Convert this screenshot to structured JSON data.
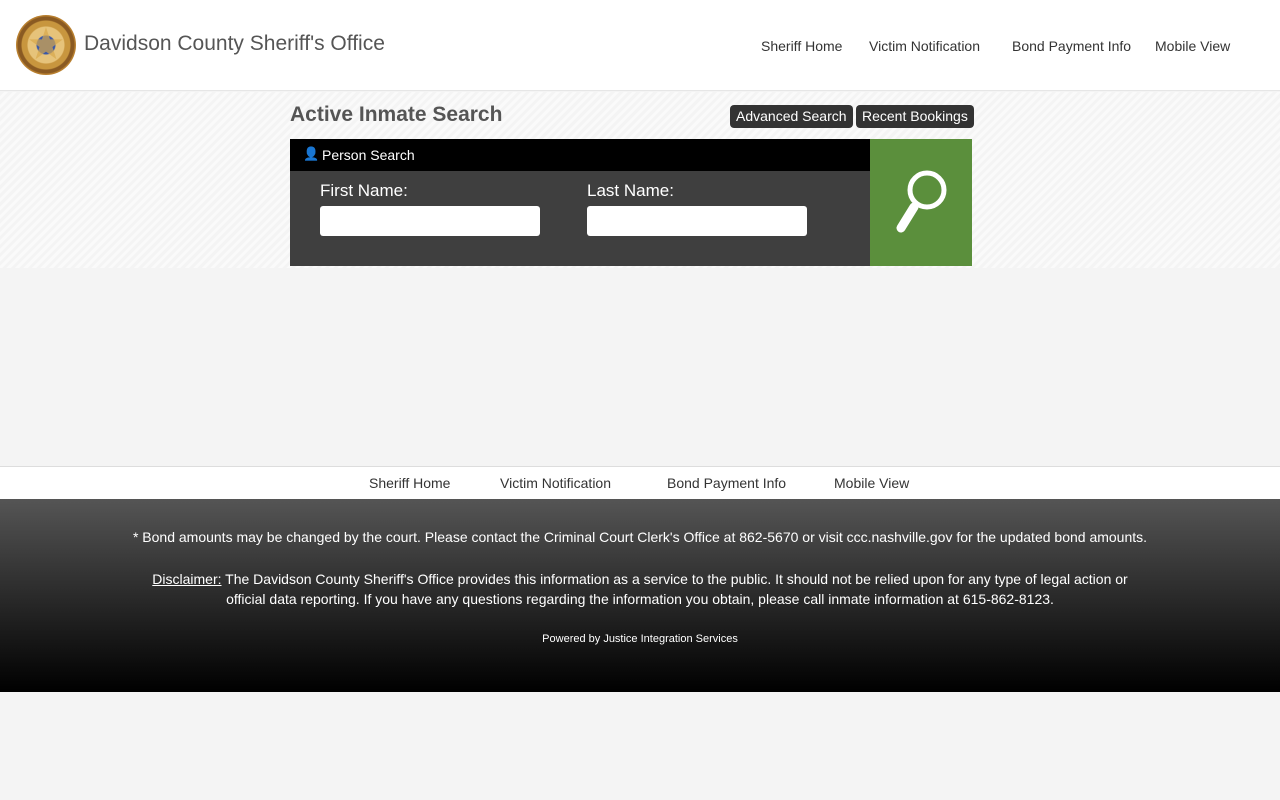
{
  "header": {
    "title": "Davidson County Sheriff's Office",
    "nav": [
      "Sheriff Home",
      "Victim Notification",
      "Bond Payment Info",
      "Mobile View"
    ]
  },
  "main": {
    "title": "Active Inmate Search",
    "advanced_label": "Advanced Search",
    "recent_label": "Recent Bookings",
    "panel_title": "Person Search",
    "first_label": "First Name:",
    "last_label": "Last Name:",
    "first_value": "",
    "last_value": "",
    "accent": "#5b8f3c"
  },
  "footer_nav": [
    "Sheriff Home",
    "Victim Notification",
    "Bond Payment Info",
    "Mobile View"
  ],
  "footer": {
    "bond_note": "* Bond amounts may be changed by the court. Please contact the Criminal Court Clerk's Office at 862-5670 or visit ccc.nashville.gov for the updated bond amounts.",
    "disclaimer_label": "Disclaimer:",
    "disclaimer_text": " The Davidson County Sheriff's Office provides this information as a service to the public. It should not be relied upon for any type of legal action or official data reporting. If you have any questions regarding the information you obtain, please call inmate information at 615-862-8123.",
    "powered": "Powered by Justice Integration Services"
  }
}
